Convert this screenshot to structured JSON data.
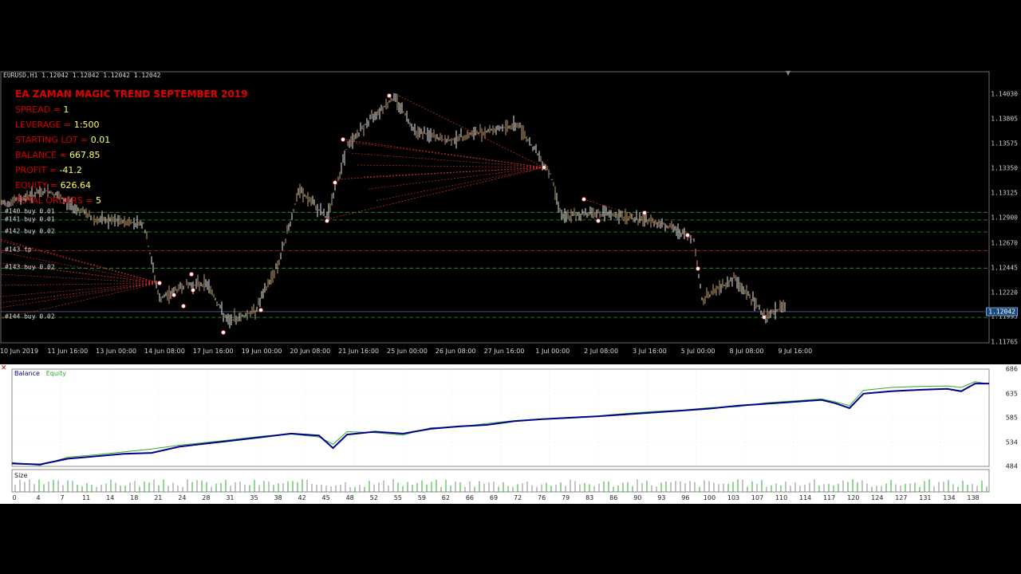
{
  "chart": {
    "title_line": "EURUSD,H1  1.12042 1.12042 1.12042 1.12042",
    "colors": {
      "background": "#000000",
      "candle_up": "#e8e8e8",
      "candle_wick": "#c8a070",
      "grid_green": "#2aa02a",
      "grid_red": "#cc2020",
      "order_red": "#e03030",
      "current_price_bg": "#1a4a7a"
    }
  },
  "info": {
    "ea_title": "EA ZAMAN MAGIC TREND SEPTEMBER 2019",
    "spread_label": "SPREAD = ",
    "spread_value": "1",
    "leverage_label": "LEVERAGE = ",
    "leverage_value": "1:500",
    "lot_label": "STARTING LOT = ",
    "lot_value": "0.01",
    "balance_label": "BALANCE = ",
    "balance_value": "667.85",
    "profit_label": "PROFIT = ",
    "profit_value": "-41.2",
    "equity_label": "EQUITY = ",
    "equity_value": "626.64",
    "orders_label": "TOTAL ORDERS = ",
    "orders_value": "5"
  },
  "price_axis": [
    "1.14030",
    "1.13805",
    "1.13575",
    "1.13350",
    "1.13125",
    "1.12900",
    "1.12670",
    "1.12445",
    "1.12220",
    "1.11995",
    "1.11765"
  ],
  "current_price": "1.12042",
  "orders": [
    {
      "label": "#140 buy 0.01",
      "price": 1.1295
    },
    {
      "label": "#141 buy 0.01",
      "price": 1.1288
    },
    {
      "label": "#142 buy 0.02",
      "price": 1.1277
    },
    {
      "label": "#143 tp",
      "price": 1.126
    },
    {
      "label": "#143 buy 0.02",
      "price": 1.1244
    },
    {
      "label": "#144 buy 0.02",
      "price": 1.1199
    }
  ],
  "time_axis": [
    "10 Jun 2019",
    "11 Jun 16:00",
    "13 Jun 00:00",
    "14 Jun 08:00",
    "17 Jun 16:00",
    "19 Jun 00:00",
    "20 Jun 08:00",
    "21 Jun 16:00",
    "25 Jun 00:00",
    "26 Jun 08:00",
    "27 Jun 16:00",
    "1 Jul 00:00",
    "2 Jul 08:00",
    "3 Jul 16:00",
    "5 Jul 00:00",
    "8 Jul 08:00",
    "9 Jul 16:00"
  ],
  "chart_data": {
    "type": "line",
    "series": [
      {
        "name": "Balance",
        "color": "#00008b",
        "values": [
          [
            0,
            490
          ],
          [
            4,
            488
          ],
          [
            8,
            500
          ],
          [
            12,
            505
          ],
          [
            16,
            510
          ],
          [
            20,
            512
          ],
          [
            24,
            525
          ],
          [
            30,
            535
          ],
          [
            36,
            545
          ],
          [
            40,
            552
          ],
          [
            44,
            548
          ],
          [
            46,
            522
          ],
          [
            48,
            550
          ],
          [
            52,
            556
          ],
          [
            56,
            552
          ],
          [
            60,
            562
          ],
          [
            64,
            567
          ],
          [
            68,
            570
          ],
          [
            72,
            578
          ],
          [
            76,
            582
          ],
          [
            80,
            585
          ],
          [
            84,
            588
          ],
          [
            88,
            592
          ],
          [
            92,
            596
          ],
          [
            96,
            600
          ],
          [
            100,
            604
          ],
          [
            104,
            610
          ],
          [
            108,
            614
          ],
          [
            112,
            618
          ],
          [
            116,
            622
          ],
          [
            118,
            615
          ],
          [
            120,
            605
          ],
          [
            122,
            635
          ],
          [
            126,
            640
          ],
          [
            130,
            643
          ],
          [
            134,
            645
          ],
          [
            136,
            640
          ],
          [
            138,
            656
          ],
          [
            140,
            656
          ]
        ]
      },
      {
        "name": "Equity",
        "color": "#2eaa2e",
        "values": [
          [
            0,
            492
          ],
          [
            4,
            486
          ],
          [
            8,
            503
          ],
          [
            12,
            508
          ],
          [
            16,
            514
          ],
          [
            20,
            520
          ],
          [
            24,
            528
          ],
          [
            30,
            537
          ],
          [
            36,
            547
          ],
          [
            40,
            551
          ],
          [
            44,
            545
          ],
          [
            46,
            530
          ],
          [
            48,
            556
          ],
          [
            52,
            554
          ],
          [
            56,
            549
          ],
          [
            60,
            564
          ],
          [
            64,
            566
          ],
          [
            68,
            573
          ],
          [
            72,
            579
          ],
          [
            76,
            583
          ],
          [
            80,
            586
          ],
          [
            84,
            589
          ],
          [
            88,
            594
          ],
          [
            92,
            598
          ],
          [
            96,
            601
          ],
          [
            100,
            606
          ],
          [
            104,
            608
          ],
          [
            108,
            616
          ],
          [
            112,
            620
          ],
          [
            116,
            624
          ],
          [
            118,
            618
          ],
          [
            120,
            610
          ],
          [
            122,
            642
          ],
          [
            126,
            648
          ],
          [
            130,
            650
          ],
          [
            134,
            651
          ],
          [
            136,
            648
          ],
          [
            138,
            660
          ],
          [
            140,
            655
          ]
        ]
      }
    ],
    "ylim": [
      484,
      686
    ],
    "y_ticks": [
      "686",
      "635",
      "585",
      "534",
      "484"
    ],
    "x_ticks": [
      "0",
      "4",
      "7",
      "11",
      "14",
      "18",
      "21",
      "24",
      "28",
      "31",
      "35",
      "38",
      "42",
      "45",
      "48",
      "52",
      "55",
      "59",
      "62",
      "66",
      "69",
      "72",
      "76",
      "79",
      "83",
      "86",
      "90",
      "93",
      "96",
      "100",
      "103",
      "107",
      "110",
      "114",
      "117",
      "120",
      "124",
      "127",
      "131",
      "134",
      "138"
    ],
    "xlim": [
      0,
      140
    ],
    "legend_balance": "Balance",
    "legend_sep": " / ",
    "legend_equity": "Equity",
    "size_label": "Size"
  }
}
